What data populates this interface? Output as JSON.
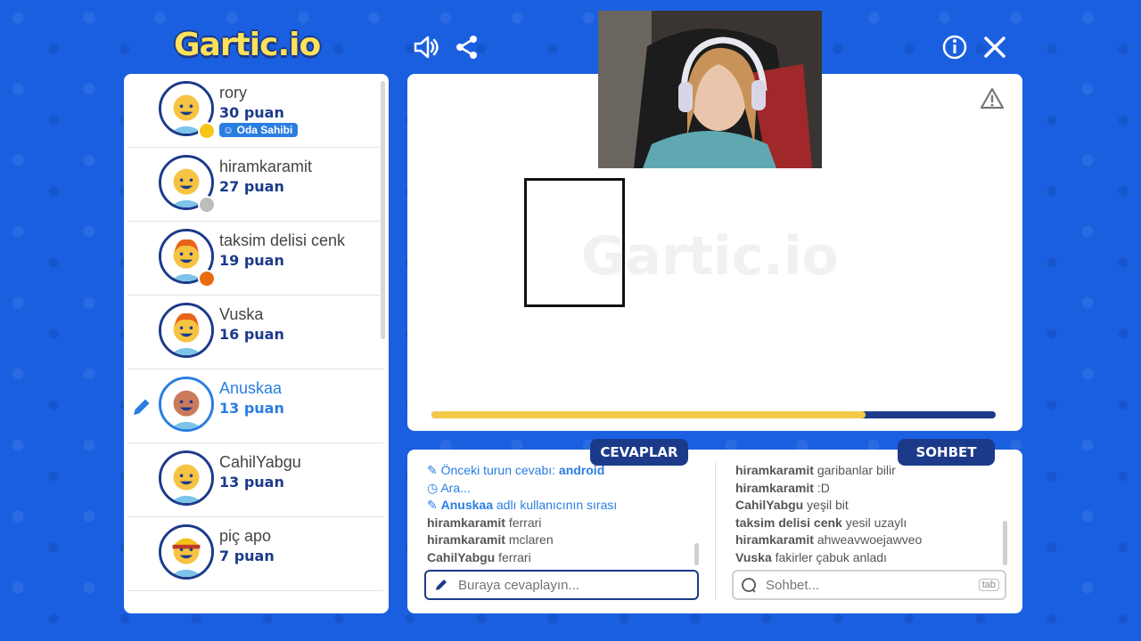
{
  "app": {
    "logo_text": "Gartic.io",
    "icons": {
      "sound": "speaker-icon",
      "share": "share-icon",
      "info": "info-icon",
      "close": "close-icon",
      "report": "warning-icon"
    }
  },
  "players": [
    {
      "name": "rory",
      "points": "30 puan",
      "badge": "Oda Sahibi",
      "status_color": "#f5c518",
      "avatar": "yellow"
    },
    {
      "name": "hiramkaramit",
      "points": "27 puan",
      "status_color": "#bdbdbd",
      "avatar": "yellow"
    },
    {
      "name": "taksim delisi cenk",
      "points": "19 puan",
      "status_color": "#e86a12",
      "avatar": "orange"
    },
    {
      "name": "Vuska",
      "points": "16 puan",
      "avatar": "orange"
    },
    {
      "name": "Anuskaa",
      "points": "13 puan",
      "drawing": true,
      "avatar": "brown"
    },
    {
      "name": "CahilYabgu",
      "points": "13 puan",
      "avatar": "yellow"
    },
    {
      "name": "piç apo",
      "points": "7 puan",
      "avatar": "cap"
    }
  ],
  "canvas": {
    "watermark": "Gartic.io",
    "timer_fraction": 0.77
  },
  "tabs": {
    "answers": "CEVAPLAR",
    "chat": "SOHBET"
  },
  "answers": {
    "previous_label": "Önceki turun cevabı:",
    "previous_value": "android",
    "waiting": "Ara...",
    "turn_user": "Anuskaa",
    "turn_text": "adlı kullanıcının sırası",
    "lines": [
      {
        "user": "hiramkaramit",
        "text": "ferrari"
      },
      {
        "user": "hiramkaramit",
        "text": "mclaren"
      },
      {
        "user": "CahilYabgu",
        "text": "ferrari"
      }
    ],
    "placeholder": "Buraya cevaplayın..."
  },
  "chat": {
    "lines": [
      {
        "user": "hiramkaramit",
        "text": "garibanlar bilir"
      },
      {
        "user": "hiramkaramit",
        "text": ":D"
      },
      {
        "user": "CahilYabgu",
        "text": "yeşil bit"
      },
      {
        "user": "taksim delisi cenk",
        "text": "yesil uzaylı"
      },
      {
        "user": "hiramkaramit",
        "text": "ahweavwoejawveo"
      },
      {
        "user": "Vuska",
        "text": "fakirler çabuk anladı"
      }
    ],
    "placeholder": "Sohbet...",
    "tab_hint": "tab"
  }
}
